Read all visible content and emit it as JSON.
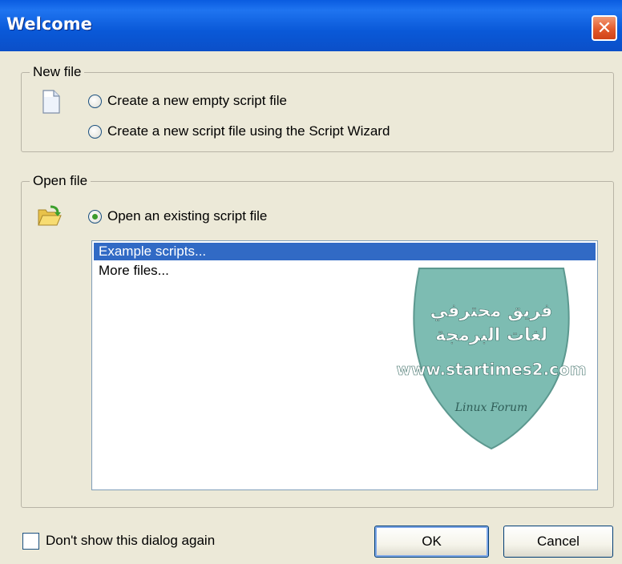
{
  "window": {
    "title": "Welcome",
    "close_symbol": "✕"
  },
  "new_file": {
    "legend": "New file",
    "icon": "document-icon",
    "options": [
      {
        "label": "Create a new empty script file",
        "checked": false
      },
      {
        "label": "Create a new script file using the Script Wizard",
        "checked": false
      }
    ]
  },
  "open_file": {
    "legend": "Open file",
    "icon": "open-folder-icon",
    "option": {
      "label": "Open an existing script file",
      "checked": true
    },
    "list_items": [
      {
        "label": "Example scripts...",
        "selected": true
      },
      {
        "label": "More files...",
        "selected": false
      }
    ]
  },
  "footer": {
    "dont_show_label": "Don't show this dialog again",
    "dont_show_checked": false,
    "ok_label": "OK",
    "cancel_label": "Cancel"
  },
  "watermark": {
    "line1": "فريق محترفي",
    "line2": "لغات البرمجة",
    "line3": "www.startimes2.com",
    "line4": "Linux Forum"
  },
  "colors": {
    "title_bar": "#0a59d8",
    "selection": "#316ac5",
    "dialog_bg": "#ece9d8"
  }
}
